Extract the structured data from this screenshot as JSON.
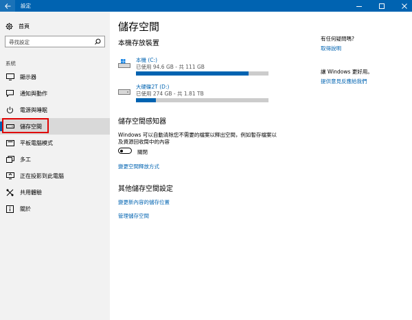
{
  "window": {
    "title": "設定",
    "back_icon": "back-arrow-icon",
    "controls": [
      "minimize-icon",
      "maximize-icon",
      "close-icon"
    ]
  },
  "colors": {
    "accent": "#0063b1",
    "sidebar_bg": "#f2f2f2",
    "selected_bg": "#d9d9d9",
    "highlight_box": "#e00000"
  },
  "sidebar": {
    "home": {
      "label": "首頁",
      "icon": "gear-icon"
    },
    "search": {
      "placeholder": "尋找設定",
      "icon": "search-icon"
    },
    "section_label": "系統",
    "items": [
      {
        "label": "顯示器",
        "icon": "monitor-icon",
        "selected": false
      },
      {
        "label": "通知與動作",
        "icon": "notification-icon",
        "selected": false
      },
      {
        "label": "電源與睡眠",
        "icon": "power-icon",
        "selected": false
      },
      {
        "label": "儲存空間",
        "icon": "storage-icon",
        "selected": true
      },
      {
        "label": "平板電腦模式",
        "icon": "tablet-icon",
        "selected": false
      },
      {
        "label": "多工",
        "icon": "multitask-icon",
        "selected": false
      },
      {
        "label": "正在投影到此電腦",
        "icon": "project-icon",
        "selected": false
      },
      {
        "label": "共用體驗",
        "icon": "shared-icon",
        "selected": false
      },
      {
        "label": "關於",
        "icon": "info-icon",
        "selected": false
      }
    ]
  },
  "main": {
    "title": "儲存空間",
    "local_storage": {
      "heading": "本機存放裝置",
      "drives": [
        {
          "name": "本機 (C:)",
          "usage": "已使用 94.6 GB - 共 111 GB",
          "used_fraction": 0.852,
          "icon": "windows-drive-icon"
        },
        {
          "name": "大硬碟2T (D:)",
          "usage": "已使用 274 GB - 共 1.81 TB",
          "used_fraction": 0.148,
          "icon": "drive-icon"
        }
      ]
    },
    "storage_sense": {
      "heading": "儲存空間感知器",
      "description": "Windows 可以自動清除您不需要的檔案以釋出空間，例如暫存檔案以及資源回收筒中的內容",
      "toggle_state": "關閉",
      "link": "變更空間釋放方式"
    },
    "more_settings": {
      "heading": "其他儲存空間設定",
      "links": [
        "變更新內容的儲存位置",
        "管理儲存空間"
      ]
    }
  },
  "right": {
    "question": "有任何疑問嗎?",
    "help_link": "取得說明",
    "improve": "讓 Windows 更好用。",
    "feedback_link": "提供意見反應給我們"
  }
}
